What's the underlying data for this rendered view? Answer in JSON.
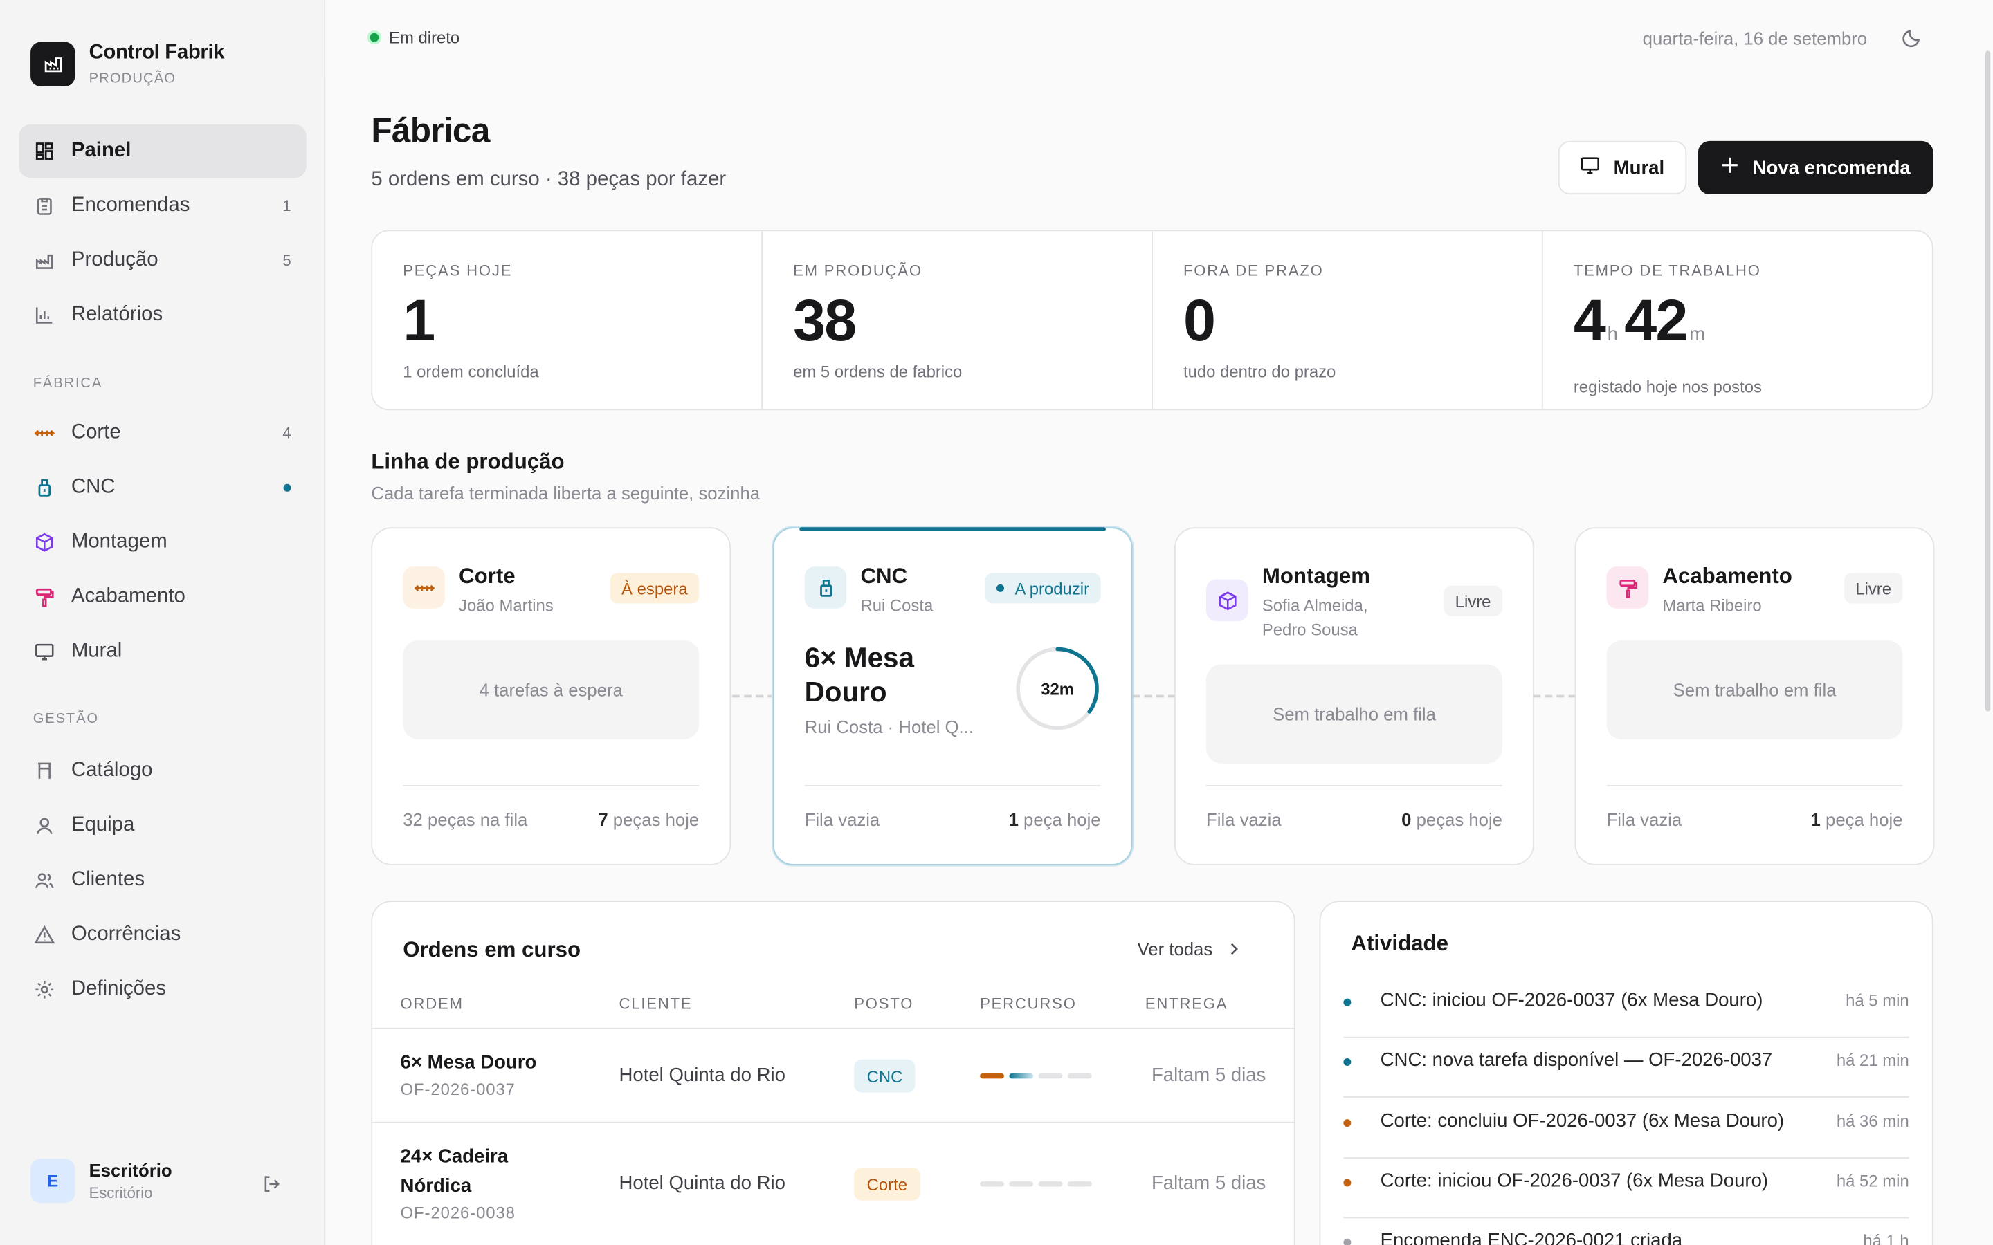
{
  "brand": {
    "title": "Control Fabrik",
    "subtitle": "PRODUÇÃO"
  },
  "nav_main": [
    {
      "label": "Painel",
      "icon": "dashboard-icon",
      "count": ""
    },
    {
      "label": "Encomendas",
      "icon": "clipboard-icon",
      "count": "1"
    },
    {
      "label": "Produção",
      "icon": "factory-icon",
      "count": "5"
    },
    {
      "label": "Relatórios",
      "icon": "bar-chart-icon",
      "count": ""
    }
  ],
  "section_fabrica": "FÁBRICA",
  "nav_fabrica": [
    {
      "label": "Corte",
      "icon": "saw-icon",
      "color": "#c2620f"
    },
    {
      "label": "CNC",
      "icon": "cnc-icon",
      "color": "#0e7490"
    },
    {
      "label": "Montagem",
      "icon": "box-icon",
      "color": "#7c3aed"
    },
    {
      "label": "Acabamento",
      "icon": "paint-roller-icon",
      "color": "#db2777"
    },
    {
      "label": "Mural",
      "icon": "monitor-icon",
      "color": "#52525b"
    }
  ],
  "corte_count": "4",
  "section_gestao": "GESTÃO",
  "nav_gestao": [
    {
      "label": "Catálogo",
      "icon": "catalog-icon"
    },
    {
      "label": "Equipa",
      "icon": "user-icon"
    },
    {
      "label": "Clientes",
      "icon": "users-icon"
    },
    {
      "label": "Ocorrências",
      "icon": "warning-icon"
    },
    {
      "label": "Definições",
      "icon": "settings-icon"
    }
  ],
  "user": {
    "initial": "E",
    "name": "Escritório",
    "role": "Escritório"
  },
  "topbar": {
    "live": "Em direto",
    "date": "quarta-feira, 16 de setembro"
  },
  "page": {
    "title": "Fábrica",
    "subtitle": "5 ordens em curso · 38 peças por fazer"
  },
  "actions": {
    "mural": "Mural",
    "new_order": "Nova encomenda"
  },
  "stats": [
    {
      "label": "PEÇAS HOJE",
      "value": "1",
      "note": "1 ordem concluída"
    },
    {
      "label": "EM PRODUÇÃO",
      "value": "38",
      "note": "em 5 ordens de fabrico"
    },
    {
      "label": "FORA DE PRAZO",
      "value": "0",
      "note": "tudo dentro do prazo"
    },
    {
      "label": "TEMPO DE TRABALHO",
      "hours": "4",
      "h_unit": "h",
      "minutes": "42",
      "m_unit": "m",
      "note": "registado hoje nos postos"
    }
  ],
  "line": {
    "title": "Linha de produção",
    "subtitle": "Cada tarefa terminada liberta a seguinte, sozinha"
  },
  "stations": [
    {
      "name": "Corte",
      "operator": "João Martins",
      "badge": "À espera",
      "empty": "4 tarefas à espera",
      "left": "32 peças na fila",
      "right_num": "7",
      "right_text": " peças hoje"
    },
    {
      "name": "CNC",
      "operator": "Rui Costa",
      "badge": "A produzir",
      "job": "6× Mesa Douro",
      "job_sub": "Rui Costa · Hotel Q...",
      "timer": "32m",
      "timer_progress": 0.35,
      "left": "Fila vazia",
      "right_num": "1",
      "right_text": " peça hoje"
    },
    {
      "name": "Montagem",
      "operator": "Sofia Almeida, Pedro Sousa",
      "badge": "Livre",
      "empty": "Sem trabalho em fila",
      "left": "Fila vazia",
      "right_num": "0",
      "right_text": " peças hoje"
    },
    {
      "name": "Acabamento",
      "operator": "Marta Ribeiro",
      "badge": "Livre",
      "empty": "Sem trabalho em fila",
      "left": "Fila vazia",
      "right_num": "1",
      "right_text": " peça hoje"
    }
  ],
  "orders": {
    "title": "Ordens em curso",
    "link": "Ver todas",
    "columns": [
      "ORDEM",
      "CLIENTE",
      "POSTO",
      "PERCURSO",
      "ENTREGA"
    ],
    "rows": [
      {
        "name": "6× Mesa Douro",
        "code": "OF-2026-0037",
        "client": "Hotel Quinta do Rio",
        "post": "CNC",
        "due": "Faltam 5 dias"
      },
      {
        "name": "24× Cadeira Nórdica",
        "code": "OF-2026-0038",
        "client": "Hotel Quinta do Rio",
        "post": "Corte",
        "due": "Faltam 5 dias"
      }
    ]
  },
  "activity": {
    "title": "Atividade",
    "items": [
      {
        "text": "CNC: iniciou OF-2026-0037 (6x Mesa Douro)",
        "time": "há 5 min",
        "color": "#0e7490"
      },
      {
        "text": "CNC: nova tarefa disponível — OF-2026-0037",
        "time": "há 21 min",
        "color": "#0e7490"
      },
      {
        "text": "Corte: concluiu OF-2026-0037 (6x Mesa Douro)",
        "time": "há 36 min",
        "color": "#c2620f"
      },
      {
        "text": "Corte: iniciou OF-2026-0037 (6x Mesa Douro)",
        "time": "há 52 min",
        "color": "#c2620f"
      },
      {
        "text": "Encomenda ENC-2026-0021 criada",
        "time": "há 1 h",
        "color": "#a1a1aa"
      }
    ]
  }
}
